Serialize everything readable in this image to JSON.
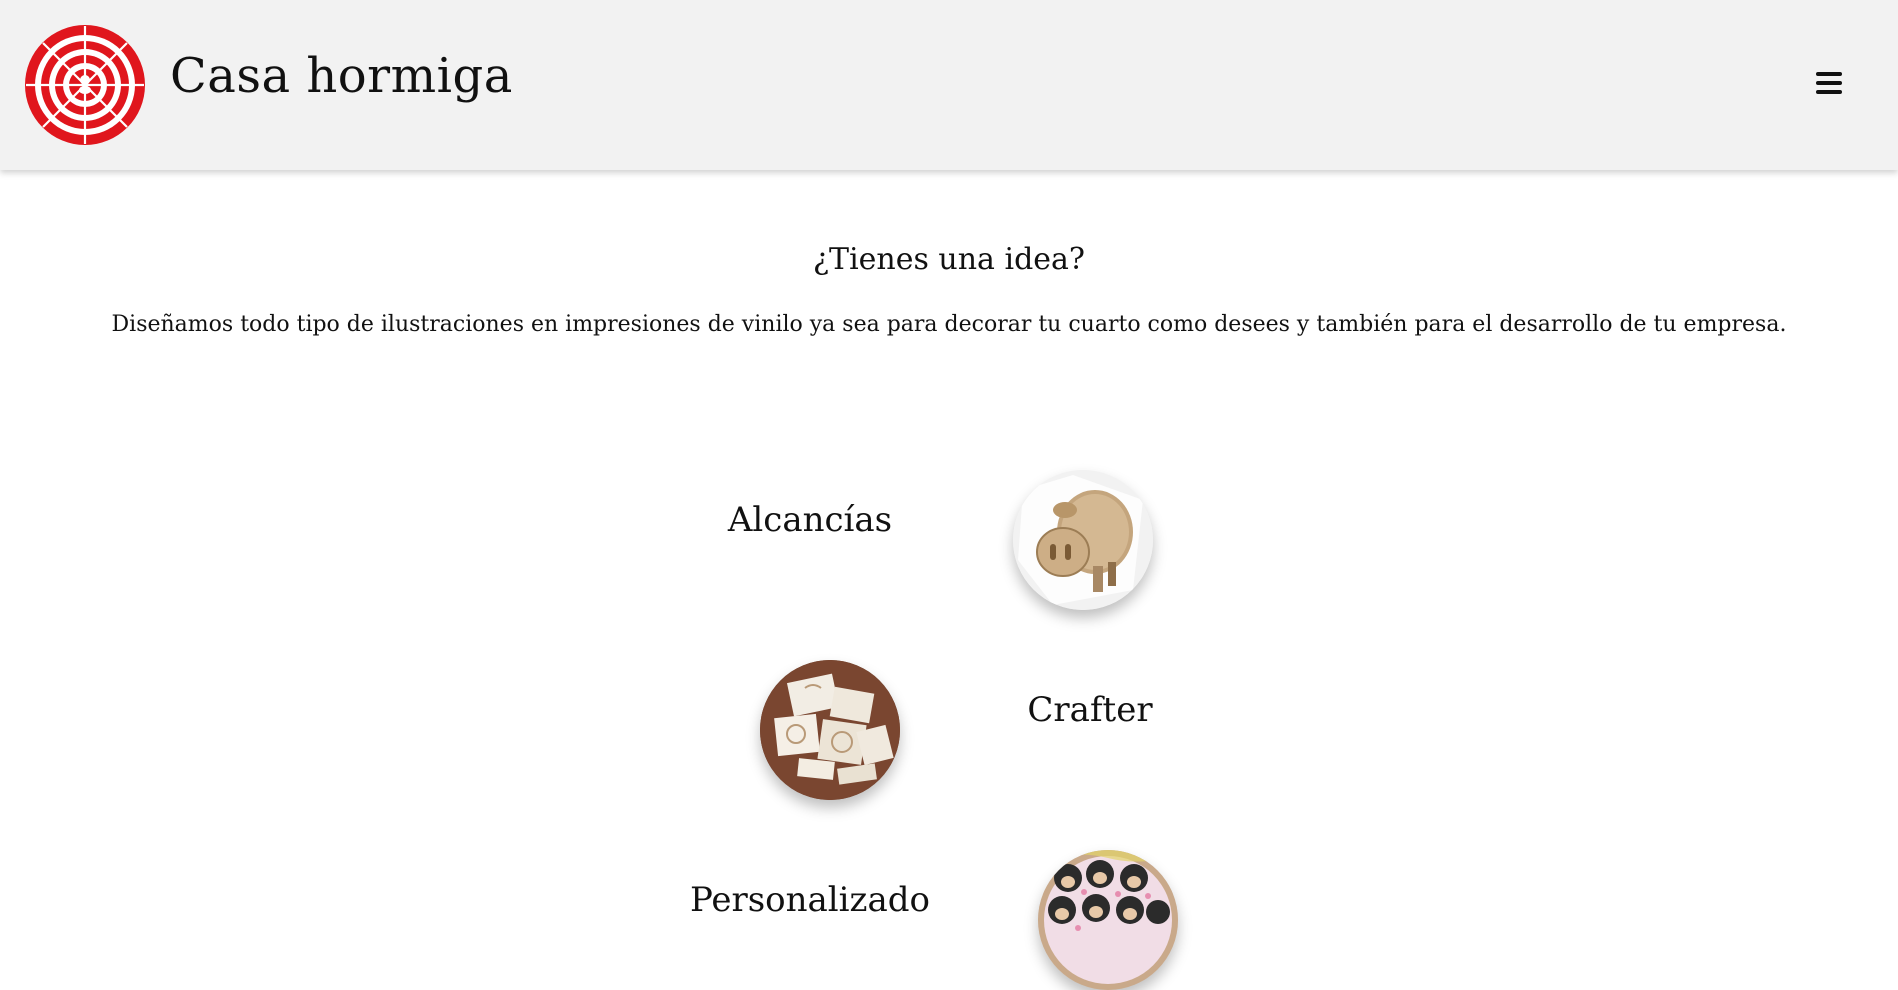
{
  "header": {
    "brand": "Casa hormiga",
    "logo_icon": "spiral-logo-icon",
    "menu_icon": "hamburger-menu-icon",
    "brand_color": "#e0161d"
  },
  "intro": {
    "title": "¿Tienes una idea?",
    "text": "Diseñamos todo tipo de ilustraciones en impresiones de vinilo ya sea para decorar tu cuarto como desees y también para el desarrollo de tu empresa."
  },
  "categories": [
    {
      "label": "Alcancías",
      "image": "wooden-pig-piggy-bank"
    },
    {
      "label": "Crafter",
      "image": "craft-cutouts-on-wood"
    },
    {
      "label": "Personalizado",
      "image": "monkey-sticker-sheet"
    }
  ]
}
